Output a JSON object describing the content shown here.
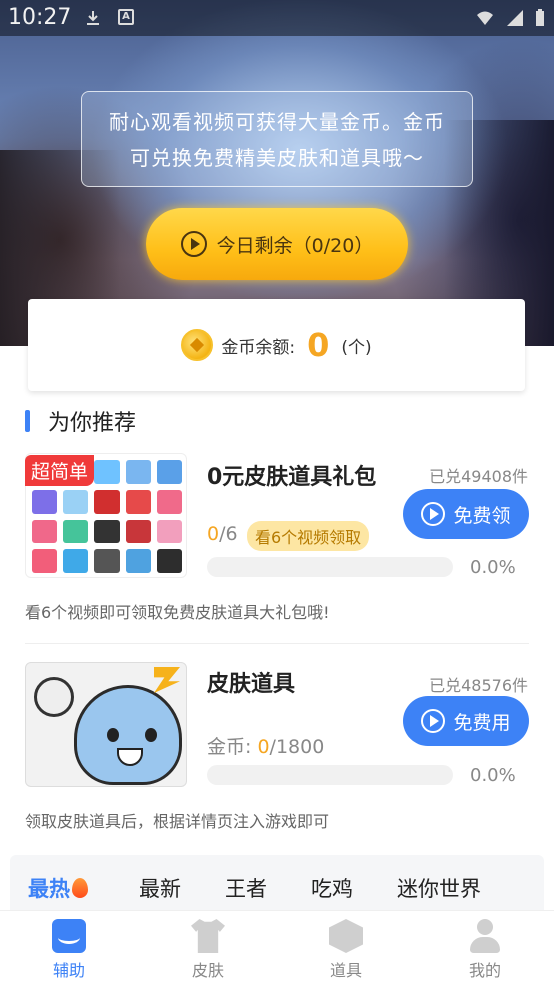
{
  "status_bar": {
    "time": "10:27"
  },
  "banner": {
    "notice_text": "耐心观看视频可获得大量金币。金币可兑换免费精美皮肤和道具哦～",
    "today_button": "今日剩余（0/20）"
  },
  "balance": {
    "label": "金币余额:",
    "value": "0",
    "unit": "(个)"
  },
  "section": {
    "title": "为你推荐"
  },
  "items": [
    {
      "tag": "超简单",
      "title": "0元皮肤道具礼包",
      "claimed": "已兑49408件",
      "button": "免费领",
      "progress_current": "0",
      "progress_total": "/6",
      "watch_pill": "看6个视频领取",
      "percent": "0.0%",
      "progress": 0,
      "description": "看6个视频即可领取免费皮肤道具大礼包哦!"
    },
    {
      "title": "皮肤道具",
      "claimed": "已兑48576件",
      "button": "免费用",
      "cost_label": "金币: ",
      "cost_current": "0",
      "cost_total": "/1800",
      "percent": "0.0%",
      "progress": 0,
      "description": "领取皮肤道具后，根据详情页注入游戏即可"
    }
  ],
  "category_tabs": [
    "最热",
    "最新",
    "王者",
    "吃鸡",
    "迷你世界"
  ],
  "bottom_nav": [
    "辅助",
    "皮肤",
    "道具",
    "我的"
  ],
  "colors": {
    "accent": "#3d82f6",
    "gold": "#f5a623",
    "tag_red": "#f03a3a"
  },
  "icons": [
    "download-icon",
    "a-icon",
    "wifi-icon",
    "signal-icon",
    "battery-icon",
    "play-icon",
    "coin-icon",
    "fire-icon",
    "assist-icon",
    "shirt-icon",
    "cube-icon",
    "person-icon"
  ]
}
